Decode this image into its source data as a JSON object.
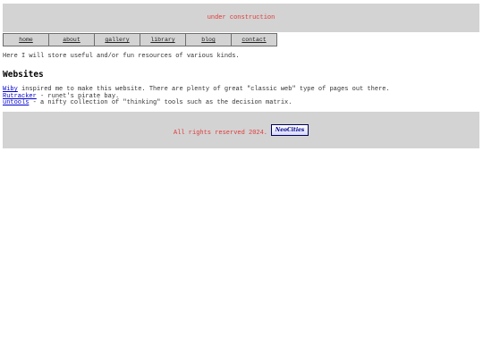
{
  "banner": {
    "text": "under construction"
  },
  "nav": {
    "items": [
      {
        "label": "home"
      },
      {
        "label": "about"
      },
      {
        "label": "gallery"
      },
      {
        "label": "library"
      },
      {
        "label": "blog"
      },
      {
        "label": "contact"
      }
    ]
  },
  "main": {
    "intro": "Here I will store useful and/or fun resources of various kinds.",
    "heading": "Websites",
    "links": [
      {
        "name": "Wiby",
        "desc": " inspired me to make this website. There are plenty of great \"classic web\" type of pages out there."
      },
      {
        "name": "Rutracker",
        "desc": " - runet's pirate bay."
      },
      {
        "name": "untools",
        "desc": " - a nifty collection of \"thinking\" tools such as the decision matrix."
      }
    ]
  },
  "footer": {
    "text": "All rights reserved 2024.",
    "badge": {
      "logo": "NeoCities",
      "sub": ""
    }
  },
  "colors": {
    "banner_bg": "#d3d3d3",
    "accent_red": "#e03a3a",
    "link_blue": "#0000cc"
  }
}
